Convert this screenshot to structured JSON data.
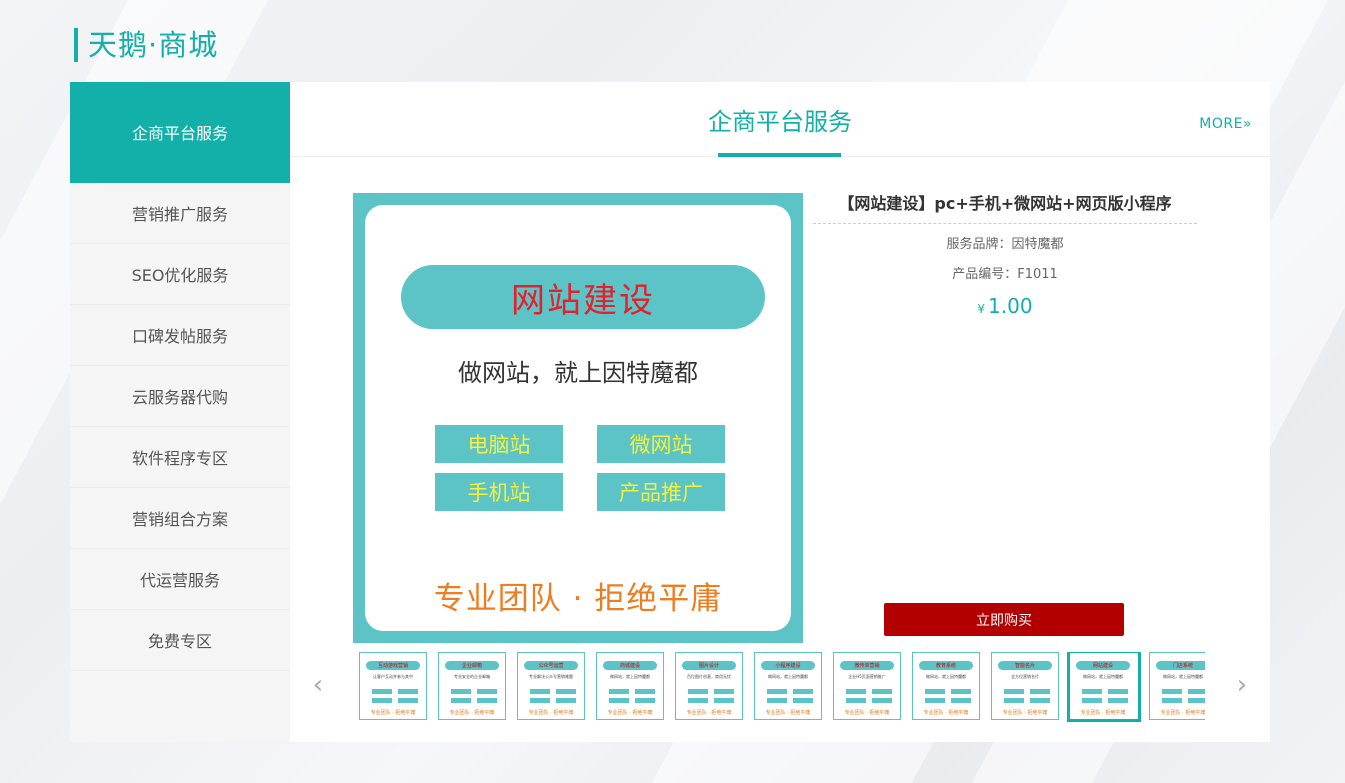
{
  "brand": {
    "name": "天鹅·商城"
  },
  "sidebar": {
    "items": [
      {
        "label": "企商平台服务"
      },
      {
        "label": "营销推广服务"
      },
      {
        "label": "SEO优化服务"
      },
      {
        "label": "口碑发帖服务"
      },
      {
        "label": "云服务器代购"
      },
      {
        "label": "软件程序专区"
      },
      {
        "label": "营销组合方案"
      },
      {
        "label": "代运营服务"
      },
      {
        "label": "免费专区"
      }
    ]
  },
  "panel": {
    "title": "企商平台服务",
    "more_label": "MORE»"
  },
  "product_image": {
    "pill_text": "网站建设",
    "slogan": "做网站，就上因特魔都",
    "chips": [
      "电脑站",
      "微网站",
      "手机站",
      "产品推广"
    ],
    "bottom_slogan": "专业团队 · 拒绝平庸"
  },
  "product": {
    "title": "【网站建设】pc+手机+微网站+网页版小程序",
    "brand_line": "服务品牌：因特魔都",
    "code_line": "产品编号：F1011",
    "currency": "¥",
    "price": "1.00",
    "buy_label": "立即购买"
  },
  "gallery": {
    "prev_icon": "‹",
    "next_icon": "›",
    "thumbs": [
      {
        "label": "互动游戏营销",
        "sub": "让客户互动并参与其中",
        "footer": "专业团队 · 拒绝平庸"
      },
      {
        "label": "企业邮箱",
        "sub": "专业安全的企业邮箱",
        "footer": "专业团队 · 拒绝平庸"
      },
      {
        "label": "公众号运营",
        "sub": "专业解决公众号营销难题",
        "footer": "专业团队 · 拒绝平庸"
      },
      {
        "label": "商城建设",
        "sub": "做网站，就上因特魔都",
        "footer": "专业团队 · 拒绝平庸"
      },
      {
        "label": "图片设计",
        "sub": "百位图片创意，商用无忧",
        "footer": "专业团队 · 拒绝平庸"
      },
      {
        "label": "小程序建设",
        "sub": "做网站，就上因特魔都",
        "footer": "专业团队 · 拒绝平庸"
      },
      {
        "label": "微传单营销",
        "sub": "企业H5页面营销推广",
        "footer": "专业团队 · 拒绝平庸"
      },
      {
        "label": "教育系统",
        "sub": "做网站，就上因特魔都",
        "footer": "专业团队 · 拒绝平庸"
      },
      {
        "label": "智能名片",
        "sub": "全方位营销名片",
        "footer": "专业团队 · 拒绝平庸"
      },
      {
        "label": "网站建设",
        "sub": "做网站，就上因特魔都",
        "footer": "专业团队 · 拒绝平庸"
      },
      {
        "label": "门店系统",
        "sub": "做网站，就上因特魔都",
        "footer": "专业团队 · 拒绝平庸"
      }
    ],
    "selected_index": 9
  },
  "colors": {
    "accent": "#12b0a9",
    "image_teal": "#5cc3c7",
    "buy_red": "#b20000",
    "pill_red": "#e3202b",
    "slogan_orange": "#ee7d21"
  }
}
